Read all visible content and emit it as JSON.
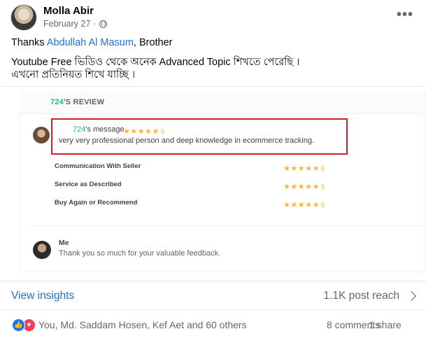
{
  "post": {
    "author": "Molla Abir",
    "date": "February 27",
    "date_separator": "·",
    "more_label": "•••",
    "text": {
      "thanks_prefix": "Thanks ",
      "mention": "Abdullah Al Masum",
      "thanks_suffix": ", Brother",
      "line2": "Youtube Free ভিডিও থেকে অনেক Advanced Topic শিখতে পেরেছি ।",
      "line3": "এখনো প্রতিনিয়ত শিখে যাচ্ছি ।"
    }
  },
  "review_card": {
    "title_prefix": "724",
    "title_suffix": "'S REVIEW",
    "reviewer_name_prefix": "724",
    "reviewer_name_suffix": "'s message",
    "stars": "★★★★★",
    "rating": "5",
    "review_text": "very very professional person and deep knowledge in ecommerce tracking.",
    "criteria": [
      {
        "label": "Communication With Seller",
        "stars": "★★★★★",
        "rating": "5"
      },
      {
        "label": "Service as Described",
        "stars": "★★★★★",
        "rating": "5"
      },
      {
        "label": "Buy Again or Recommend",
        "stars": "★★★★★",
        "rating": "5"
      }
    ],
    "reply_name": "Me",
    "reply_text": "Thank you so much for your valuable feedback."
  },
  "insights": {
    "label": "View insights",
    "reach": "1.1K post reach"
  },
  "reactions": {
    "text": "You, Md. Saddam Hosen, Kef Aet and 60 others",
    "comments": "8 comments",
    "shares": "1 share",
    "like_icon": "👍",
    "love_icon": "♥"
  },
  "colors": {
    "link": "#216fdb",
    "fiverr_green": "#1dbf73",
    "star": "#ffb33e",
    "highlight_border": "#d32222",
    "like": "#1877f2",
    "love": "#f33e58"
  }
}
